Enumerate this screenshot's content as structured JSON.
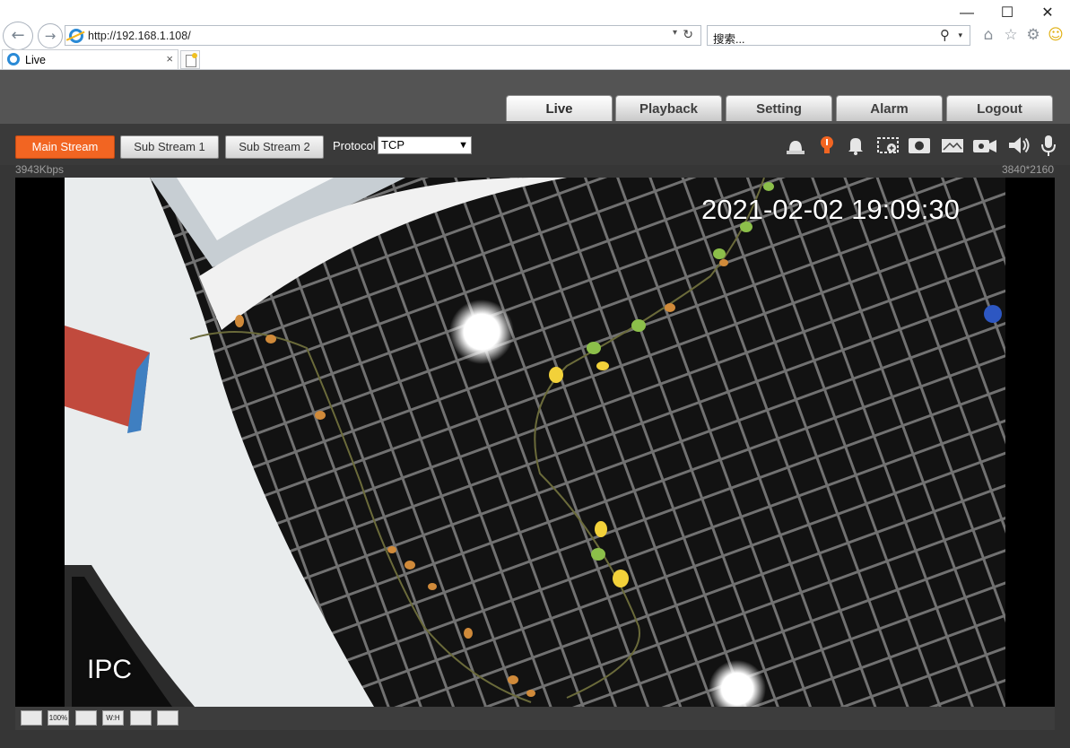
{
  "browser": {
    "window_controls": {
      "minimize": "—",
      "maximize": "☐",
      "close": "✕"
    },
    "url": "http://192.168.1.108/",
    "search_placeholder": "搜索...",
    "tab_title": "Live",
    "tab_close": "×",
    "icons": [
      "back-icon",
      "forward-icon",
      "refresh-icon",
      "search-icon",
      "home-icon",
      "favorites-icon",
      "settings-icon",
      "feedback-smiley-icon"
    ]
  },
  "nav": {
    "tabs": [
      {
        "label": "Live",
        "active": true
      },
      {
        "label": "Playback",
        "active": false
      },
      {
        "label": "Setting",
        "active": false
      },
      {
        "label": "Alarm",
        "active": false
      },
      {
        "label": "Logout",
        "active": false
      }
    ]
  },
  "toolbar": {
    "streams": [
      {
        "label": "Main Stream",
        "selected": true
      },
      {
        "label": "Sub Stream 1",
        "selected": false
      },
      {
        "label": "Sub Stream 2",
        "selected": false
      }
    ],
    "protocol_label": "Protocol",
    "protocol_value": "TCP",
    "right_icons": [
      "siren-icon",
      "light-bulb-icon",
      "alarm-bell-icon",
      "digital-zoom-icon",
      "snapshot-icon",
      "triple-snapshot-icon",
      "record-icon",
      "audio-icon",
      "talk-microphone-icon"
    ]
  },
  "status": {
    "bitrate": "3943Kbps",
    "resolution": "3840*2160"
  },
  "video": {
    "timestamp": "2021-02-02 19:09:30",
    "channel_name": "IPC"
  },
  "bottom_tools": [
    {
      "name": "image-adjust-icon",
      "label": ""
    },
    {
      "name": "original-size-icon",
      "label": "100%"
    },
    {
      "name": "fullscreen-icon",
      "label": ""
    },
    {
      "name": "aspect-ratio-icon",
      "label": "W:H"
    },
    {
      "name": "fluency-icon",
      "label": ""
    },
    {
      "name": "rules-info-icon",
      "label": ""
    }
  ],
  "colors": {
    "accent": "#f26522",
    "app_bg": "#363636",
    "topbar_bg": "#545454"
  }
}
